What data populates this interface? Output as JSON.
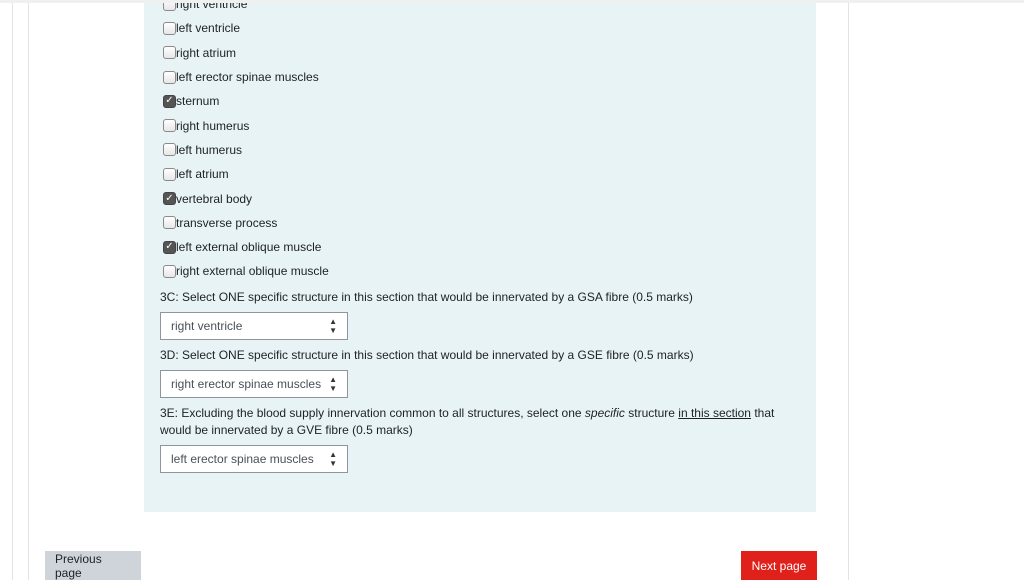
{
  "options": [
    {
      "label": "right ventricle",
      "checked": false
    },
    {
      "label": "left ventricle",
      "checked": false
    },
    {
      "label": "right atrium",
      "checked": false
    },
    {
      "label": "left erector spinae muscles",
      "checked": false
    },
    {
      "label": "sternum",
      "checked": true
    },
    {
      "label": "right humerus",
      "checked": false
    },
    {
      "label": "left humerus",
      "checked": false
    },
    {
      "label": "left atrium",
      "checked": false
    },
    {
      "label": "vertebral body",
      "checked": true
    },
    {
      "label": "transverse process",
      "checked": false
    },
    {
      "label": "left external oblique muscle",
      "checked": true
    },
    {
      "label": "right external oblique muscle",
      "checked": false
    }
  ],
  "q3c": {
    "text": "3C: Select ONE specific structure in this section that would be innervated by a GSA fibre (0.5 marks)",
    "selected": "right ventricle"
  },
  "q3d": {
    "text": "3D: Select ONE specific structure in this section that would be innervated by a GSE fibre (0.5 marks)",
    "selected": "right erector spinae muscles"
  },
  "q3e": {
    "text_a": "3E: Excluding the blood supply innervation common to all structures, select one ",
    "text_em": "specific",
    "text_b": " structure ",
    "text_u": "in this section",
    "text_c": " that would be innervated by a GVE fibre (0.5 marks)",
    "selected": "left erector spinae muscles"
  },
  "nav": {
    "prev": "Previous page",
    "next": "Next page"
  },
  "colors": {
    "panel": "#e7f3f5",
    "next": "#e0201a",
    "prev": "#ced4da"
  }
}
